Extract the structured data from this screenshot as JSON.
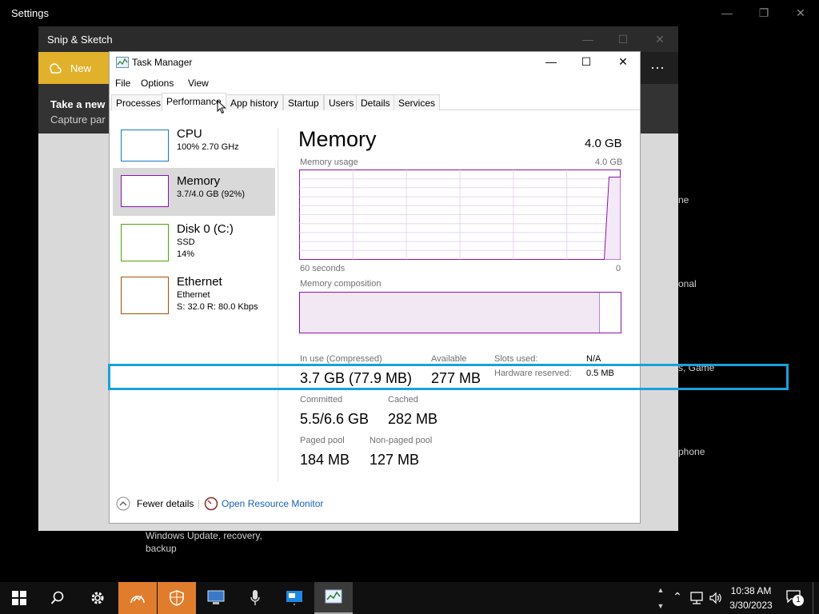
{
  "settings": {
    "title": "Settings",
    "fragments": [
      "ne",
      "onal",
      "s, Game",
      "phone"
    ],
    "update_line1": "Windows Update, recovery,",
    "update_line2": "backup"
  },
  "snip": {
    "title": "Snip & Sketch",
    "new_label": "New",
    "banner_title": "Take a new",
    "banner_sub": "Capture par",
    "more": "···"
  },
  "task_manager": {
    "title": "Task Manager",
    "menu": [
      "File",
      "Options",
      "View"
    ],
    "tabs": [
      "Processes",
      "Performance",
      "App history",
      "Startup",
      "Users",
      "Details",
      "Services"
    ],
    "sidebar": [
      {
        "name": "CPU",
        "line1": "100% 2.70 GHz",
        "line2": "",
        "color": "#117dbb"
      },
      {
        "name": "Memory",
        "line1": "3.7/4.0 GB (92%)",
        "line2": "",
        "color": "#8b12ae"
      },
      {
        "name": "Disk 0 (C:)",
        "line1": "SSD",
        "line2": "14%",
        "color": "#4da60c"
      },
      {
        "name": "Ethernet",
        "line1": "Ethernet",
        "line2": "S: 32.0 R: 80.0 Kbps",
        "color": "#a74f01"
      }
    ],
    "detail": {
      "heading": "Memory",
      "total": "4.0 GB",
      "usage_label": "Memory usage",
      "usage_max": "4.0 GB",
      "time_left": "60 seconds",
      "time_right": "0",
      "composition_label": "Memory composition",
      "usage_fraction": 0.92,
      "stats": {
        "in_use_label": "In use (Compressed)",
        "in_use_value": "3.7 GB (77.9 MB)",
        "available_label": "Available",
        "available_value": "277 MB",
        "slots_label": "Slots used:",
        "slots_value": "N/A",
        "hw_label": "Hardware reserved:",
        "hw_value": "0.5 MB",
        "committed_label": "Committed",
        "committed_value": "5.5/6.6 GB",
        "cached_label": "Cached",
        "cached_value": "282 MB",
        "paged_label": "Paged pool",
        "paged_value": "184 MB",
        "nonpaged_label": "Non-paged pool",
        "nonpaged_value": "127 MB"
      }
    },
    "fewer_details": "Fewer details",
    "open_monitor": "Open Resource Monitor"
  },
  "taskbar": {
    "time": "10:38 AM",
    "date": "3/30/2023",
    "notification_count": "1"
  }
}
